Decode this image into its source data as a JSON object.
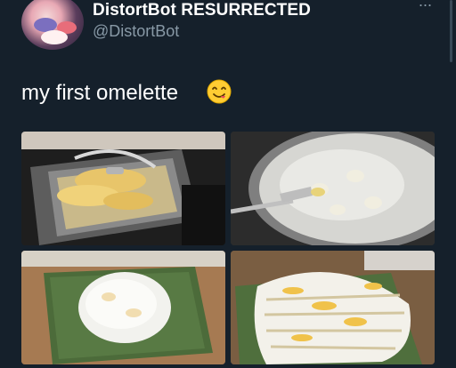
{
  "account": {
    "display_name": "DistortBot RESURRECTED",
    "handle": "@DistortBot"
  },
  "tweet": {
    "text": "my first omelette",
    "emoji": "face-savoring-food-emoji"
  },
  "menu": {
    "more_icon": "more-horizontal-icon",
    "more_glyph": "···"
  },
  "photos": [
    {
      "name": "photo-egg-in-pan",
      "description_icon": "image"
    },
    {
      "name": "photo-boiling-eggs-skillet",
      "description_icon": "image"
    },
    {
      "name": "photo-round-omelette-on-board",
      "description_icon": "image"
    },
    {
      "name": "photo-sliced-omelette-on-board",
      "description_icon": "image"
    }
  ],
  "colors": {
    "background": "#15202b",
    "secondary_text": "#8899a6",
    "primary_text": "#ffffff"
  }
}
